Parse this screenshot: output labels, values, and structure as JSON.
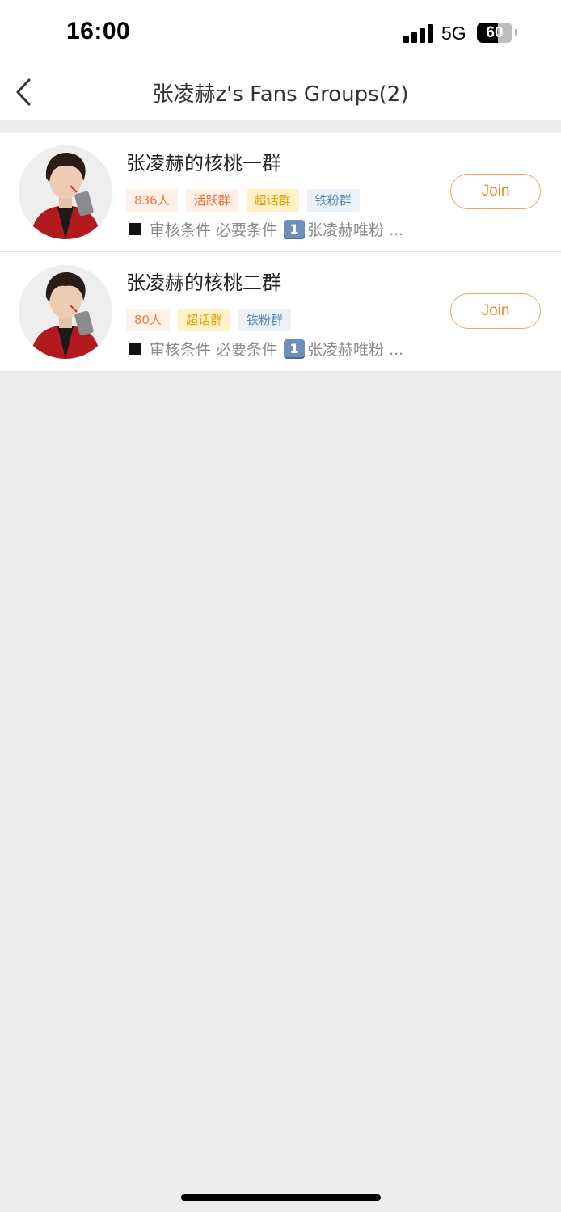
{
  "status_bar": {
    "time": "16:00",
    "network": "5G",
    "battery": "60",
    "battery_level": 0.6
  },
  "nav": {
    "title": "张凌赫z's Fans Groups(2)",
    "back_icon": "chevron-left-icon"
  },
  "groups": [
    {
      "name": "张凌赫的核桃一群",
      "tags": [
        {
          "label": "836人",
          "kind": "count"
        },
        {
          "label": "活跃群",
          "kind": "active"
        },
        {
          "label": "超话群",
          "kind": "topic"
        },
        {
          "label": "铁粉群",
          "kind": "iron"
        }
      ],
      "condition_text": "审核条件 必要条件",
      "condition_num": "1",
      "condition_tail": "张凌赫唯粉 ...",
      "join_label": "Join"
    },
    {
      "name": "张凌赫的核桃二群",
      "tags": [
        {
          "label": "80人",
          "kind": "count"
        },
        {
          "label": "超话群",
          "kind": "topic"
        },
        {
          "label": "铁粉群",
          "kind": "iron"
        }
      ],
      "condition_text": "审核条件 必要条件",
      "condition_num": "1",
      "condition_tail": "张凌赫唯粉 ...",
      "join_label": "Join"
    }
  ],
  "colors": {
    "accent": "#f08a2e",
    "background": "#ededed"
  }
}
